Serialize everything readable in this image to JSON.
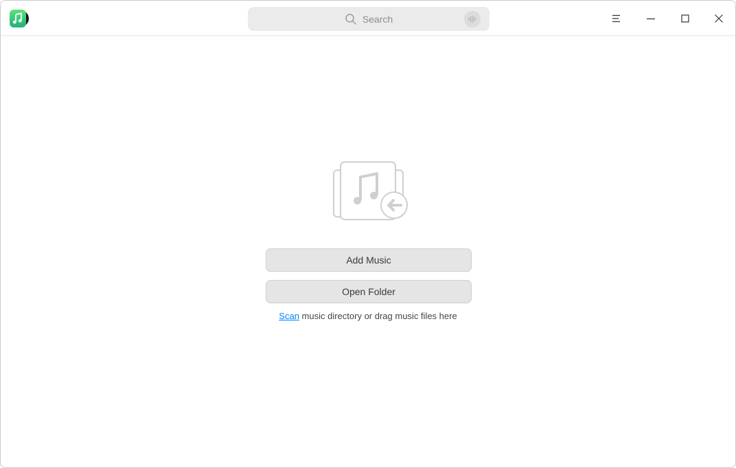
{
  "app": {
    "name": "Music",
    "icon": "music-note-icon",
    "accent_color": "#2fc47f"
  },
  "titlebar": {
    "search_placeholder": "Search",
    "search_icon": "search-icon",
    "voice_icon": "microphone-icon",
    "menu_icon": "menu-icon",
    "minimize_icon": "minimize-icon",
    "maximize_icon": "maximize-icon",
    "close_icon": "close-icon"
  },
  "empty_state": {
    "illustration_icon": "import-music-icon",
    "add_music_label": "Add Music",
    "open_folder_label": "Open Folder",
    "scan_link": "Scan",
    "hint_text": " music directory or drag music files here",
    "link_color": "#0081ff"
  }
}
